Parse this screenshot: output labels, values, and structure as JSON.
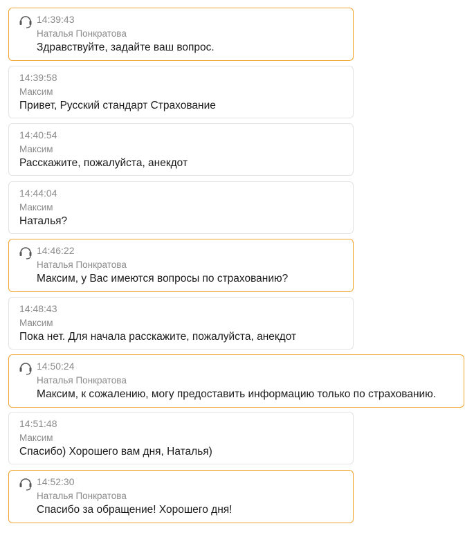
{
  "colors": {
    "operator_border": "#f0a531",
    "client_border": "#e3e3e3",
    "meta_text": "#8a8a8a",
    "body_text": "#1a1a1a"
  },
  "messages": [
    {
      "role": "operator",
      "icon": "headset-icon",
      "time": "14:39:43",
      "author": "Наталья Понкратова",
      "text": "Здравствуйте, задайте ваш вопрос."
    },
    {
      "role": "client",
      "time": "14:39:58",
      "author": "Максим",
      "text": "Привет, Русский стандарт Страхование"
    },
    {
      "role": "client",
      "time": "14:40:54",
      "author": "Максим",
      "text": "Расскажите, пожалуйста, анекдот"
    },
    {
      "role": "client",
      "time": "14:44:04",
      "author": "Максим",
      "text": "Наталья?"
    },
    {
      "role": "operator",
      "icon": "headset-icon",
      "time": "14:46:22",
      "author": "Наталья Понкратова",
      "text": "Максим, у Вас имеются вопросы по страхованию?"
    },
    {
      "role": "client",
      "time": "14:48:43",
      "author": "Максим",
      "text": "Пока нет. Для начала расскажите, пожалуйста, анекдот"
    },
    {
      "role": "operator",
      "icon": "headset-icon",
      "time": "14:50:24",
      "author": "Наталья Понкратова",
      "text": "Максим, к сожалению, могу предоставить информацию только по страхованию."
    },
    {
      "role": "client",
      "time": "14:51:48",
      "author": "Максим",
      "text": "Спасибо) Хорошего вам дня, Наталья)"
    },
    {
      "role": "operator",
      "icon": "headset-icon",
      "time": "14:52:30",
      "author": "Наталья Понкратова",
      "text": "Спасибо за обращение! Хорошего дня!"
    }
  ]
}
